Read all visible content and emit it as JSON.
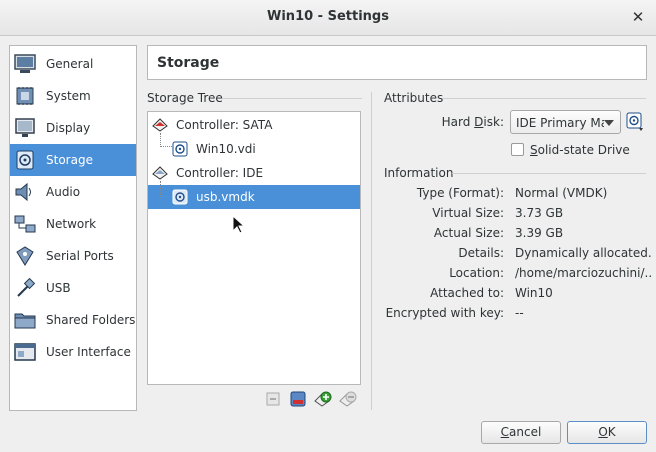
{
  "window": {
    "title": "Win10 - Settings",
    "close_glyph": "✕"
  },
  "sidebar": {
    "items": [
      {
        "label": "General",
        "icon": "general-icon"
      },
      {
        "label": "System",
        "icon": "system-chip-icon"
      },
      {
        "label": "Display",
        "icon": "monitor-icon"
      },
      {
        "label": "Storage",
        "icon": "disk-icon",
        "selected": true
      },
      {
        "label": "Audio",
        "icon": "speaker-icon"
      },
      {
        "label": "Network",
        "icon": "network-icon"
      },
      {
        "label": "Serial Ports",
        "icon": "serial-port-icon"
      },
      {
        "label": "USB",
        "icon": "usb-icon"
      },
      {
        "label": "Shared Folders",
        "icon": "folder-icon"
      },
      {
        "label": "User Interface",
        "icon": "user-interface-icon"
      }
    ]
  },
  "page_title": "Storage",
  "storage_tree": {
    "label": "Storage Tree",
    "rows": [
      {
        "label": "Controller: SATA",
        "type": "controller"
      },
      {
        "label": "Win10.vdi",
        "type": "disk"
      },
      {
        "label": "Controller: IDE",
        "type": "controller"
      },
      {
        "label": "usb.vmdk",
        "type": "disk",
        "selected": true
      }
    ]
  },
  "tree_toolbar": [
    "remove-controller-icon",
    "add-hard-disk-icon",
    "add-attachment-icon",
    "remove-attachment-icon"
  ],
  "attributes": {
    "label": "Attributes",
    "hard_disk_label_pre": "Hard ",
    "hard_disk_label_mnemonic": "D",
    "hard_disk_label_post": "isk:",
    "hard_disk_value": "IDE Primary Ma",
    "ssd_label_pre": "",
    "ssd_label_mnemonic": "S",
    "ssd_label_post": "olid-state Drive",
    "ssd_checked": false
  },
  "information": {
    "label": "Information",
    "rows": [
      {
        "label": "Type (Format):",
        "value": "Normal (VMDK)"
      },
      {
        "label": "Virtual Size:",
        "value": "3.73 GB"
      },
      {
        "label": "Actual Size:",
        "value": "3.39 GB"
      },
      {
        "label": "Details:",
        "value": "Dynamically allocated..."
      },
      {
        "label": "Location:",
        "value": "/home/marciozuchini/..."
      },
      {
        "label": "Attached to:",
        "value": "Win10"
      },
      {
        "label": "Encrypted with key:",
        "value": "--"
      }
    ]
  },
  "buttons": {
    "cancel_mnemonic": "C",
    "cancel_rest": "ancel",
    "ok_mnemonic": "O",
    "ok_rest": "K"
  },
  "colors": {
    "selection": "#4a90d9",
    "background": "#efefef",
    "panel": "#ffffff"
  }
}
